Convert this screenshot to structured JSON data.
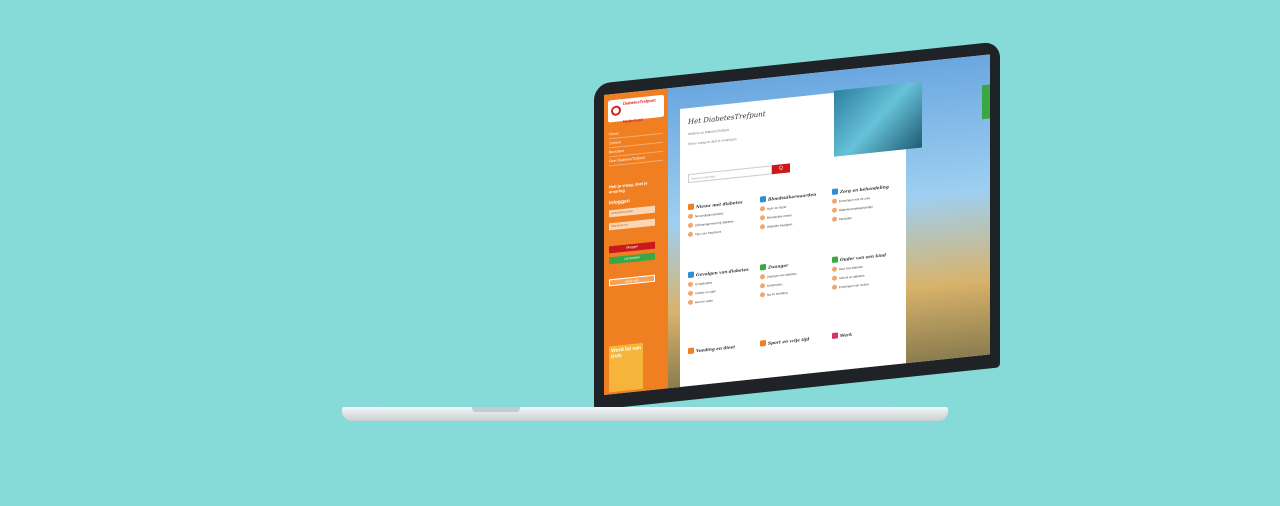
{
  "site": {
    "logo_line1": "DiabetesTrefpunt",
    "logo_line2": "Nederland"
  },
  "sidebar": {
    "nav": [
      "Home",
      "Zoeken",
      "Berichten",
      "Over DiabetesTrefpunt"
    ],
    "slogan": "Heb je vraag, deel je ervaring",
    "login_title": "Inloggen",
    "username_placeholder": "Gebruikersnaam",
    "password_placeholder": "Wachtwoord",
    "login_button": "Inloggen",
    "register_button": "Lid worden",
    "forgot_button": "Meer info",
    "ad_text": "Word lid van DVN"
  },
  "main": {
    "title": "Het DiabetesTrefpunt",
    "intro1": "Welkom op DiabetesTrefpunt.",
    "intro2": "Stel je vraag en deel je ervaringen.",
    "search_placeholder": "Zoek je onderwerp",
    "search_button": "Q",
    "feedback_tab": "Feedback"
  },
  "categories": [
    {
      "name": "Nieuw met diabetes",
      "color": "#f07f22",
      "topics": [
        "Net gediagnosticeerd",
        "Zelfmanagement bij diabetes",
        "Tips voor beginners"
      ]
    },
    {
      "name": "Bloedsuikerwaarden",
      "color": "#2f8fd6",
      "topics": [
        "Hypo en hyper",
        "Bloedsuiker meten",
        "Waarden begrijpen"
      ]
    },
    {
      "name": "Zorg en behandeling",
      "color": "#2f8fd6",
      "topics": [
        "Ervaringen met de zorg",
        "Diabetesverpleegkundige",
        "Medicatie"
      ]
    },
    {
      "name": "Gevolgen van diabetes",
      "color": "#2f8fd6",
      "topics": [
        "Complicaties",
        "Voeten en ogen",
        "Hart en vaten"
      ]
    },
    {
      "name": "Zwanger",
      "color": "#3aa745",
      "topics": [
        "Zwanger met diabetes",
        "Kinderwens",
        "Na de bevalling"
      ]
    },
    {
      "name": "Ouder van een kind",
      "color": "#3aa745",
      "topics": [
        "Kind met diabetes",
        "School en diabetes",
        "Ervaringen van ouders"
      ]
    },
    {
      "name": "Voeding en dieet",
      "color": "#f07f22",
      "topics": []
    },
    {
      "name": "Sport en vrije tijd",
      "color": "#f07f22",
      "topics": []
    },
    {
      "name": "Werk",
      "color": "#d6336c",
      "topics": []
    }
  ]
}
